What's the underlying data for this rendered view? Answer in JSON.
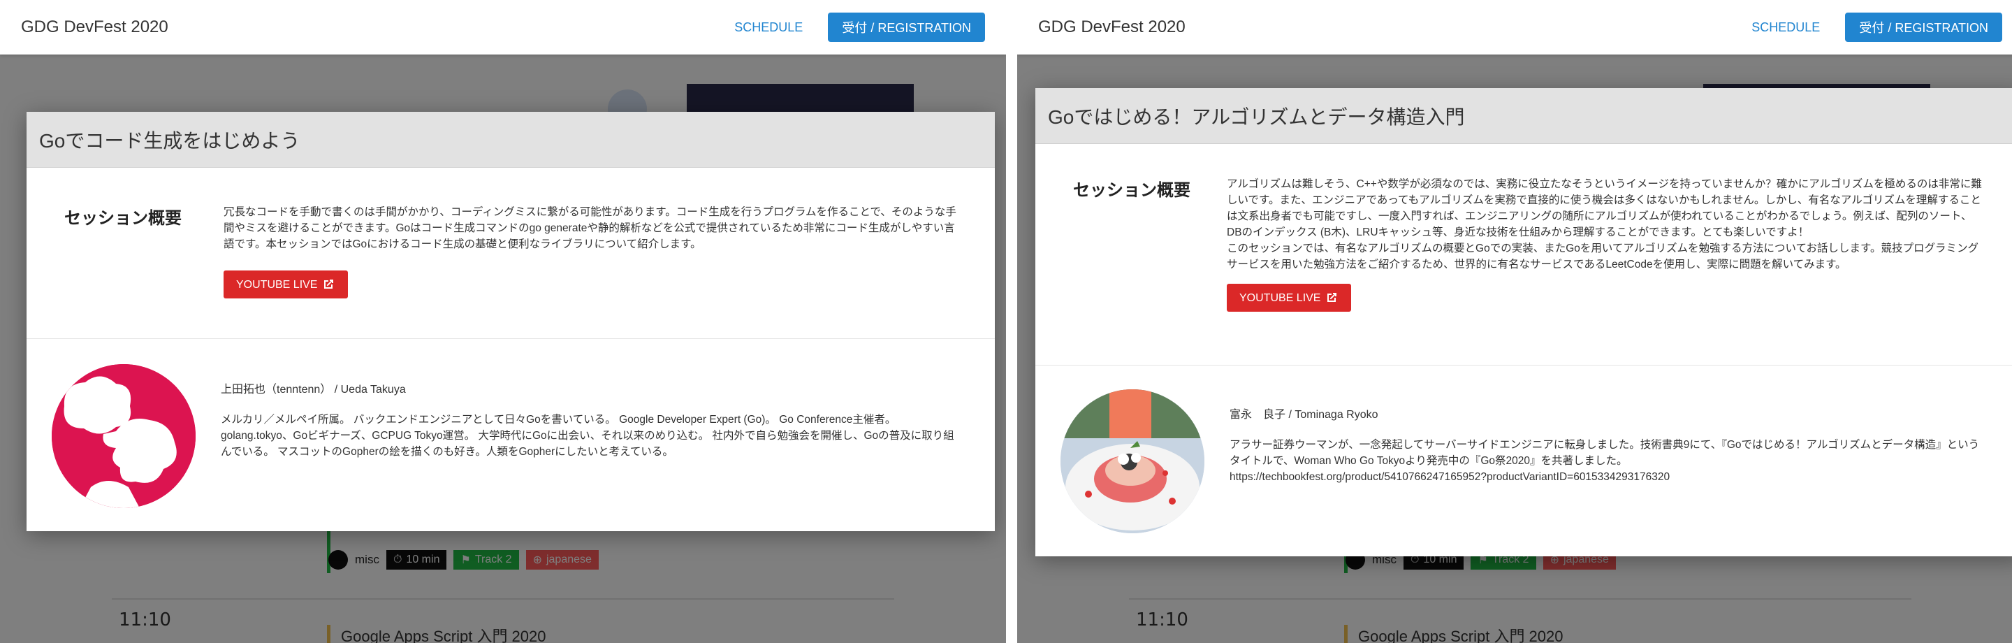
{
  "app": {
    "title": "GDG DevFest 2020",
    "nav_schedule": "SCHEDULE",
    "nav_register": "受付 / REGISTRATION"
  },
  "background": {
    "time": "11:10",
    "session_meta": {
      "category": "misc",
      "duration": "10 min",
      "track": "Track 2",
      "language": "japanese"
    },
    "next_session_title": "Google Apps Script 入門 2020"
  },
  "modal_left": {
    "title": "Goでコード生成をはじめよう",
    "section_label": "セッション概要",
    "description": "冗長なコードを手動で書くのは手間がかかり、コーディングミスに繋がる可能性があります。コード生成を行うプログラムを作ることで、そのような手間やミスを避けることができます。Goはコード生成コマンドのgo generateや静的解析などを公式で提供されているため非常にコード生成がしやすい言語です。本セッションではGoにおけるコード生成の基礎と便利なライブラリについて紹介します。",
    "youtube_label": "YOUTUBE LIVE",
    "speaker_name": "上田拓也（tenntenn） / Ueda Takuya",
    "speaker_bio": "メルカリ／メルペイ所属。 バックエンドエンジニアとして日々Goを書いている。 Google Developer Expert (Go)。 Go Conference主催者。 golang.tokyo、Goビギナーズ、GCPUG Tokyo運営。 大学時代にGoに出会い、それ以来のめり込む。 社内外で自ら勉強会を開催し、Goの普及に取り組んでいる。 マスコットのGopherの絵を描くのも好き。人類をGopherにしたいと考えている。"
  },
  "modal_right": {
    "title": "Goではじめる！アルゴリズムとデータ構造入門",
    "section_label": "セッション概要",
    "description": "アルゴリズムは難しそう、C++や数学が必須なのでは、実務に役立たなそうというイメージを持っていませんか？確かにアルゴリズムを極めるのは非常に難しいです。また、エンジニアであってもアルゴリズムを実務で直接的に使う機会は多くはないかもしれません。しかし、有名なアルゴリズムを理解することは文系出身者でも可能ですし、一度入門すれば、エンジニアリングの随所にアルゴリズムが使われていることがわかるでしょう。例えば、配列のソート、DBのインデックス (B木)、LRUキャッシュ等、身近な技術を仕組みから理解することができます。とても楽しいですよ！",
    "description2": "このセッションでは、有名なアルゴリズムの概要とGoでの実装、またGoを用いてアルゴリズムを勉強する方法についてお話しします。競技プログラミングサービスを用いた勉強方法をご紹介するため、世界的に有名なサービスであるLeetCodeを使用し、実際に問題を解いてみます。",
    "youtube_label": "YOUTUBE LIVE",
    "speaker_name": "富永　良子 / Tominaga Ryoko",
    "speaker_bio": "アラサー証券ウーマンが、一念発起してサーバーサイドエンジニアに転身しました。技術書典9にて、『Goではじめる！アルゴリズムとデータ構造』というタイトルで、Woman Who Go Tokyoより発売中の『Go祭2020』を共著しました。",
    "speaker_link": "https://techbookfest.org/product/5410766247165952?productVariantID=6015334293176320"
  },
  "colors": {
    "brand_blue": "#2185d0",
    "youtube_red": "#db2828",
    "avatar_left_bg": "#dc1450",
    "chip_green": "#21ba45",
    "chip_red": "#ff5b5b"
  }
}
